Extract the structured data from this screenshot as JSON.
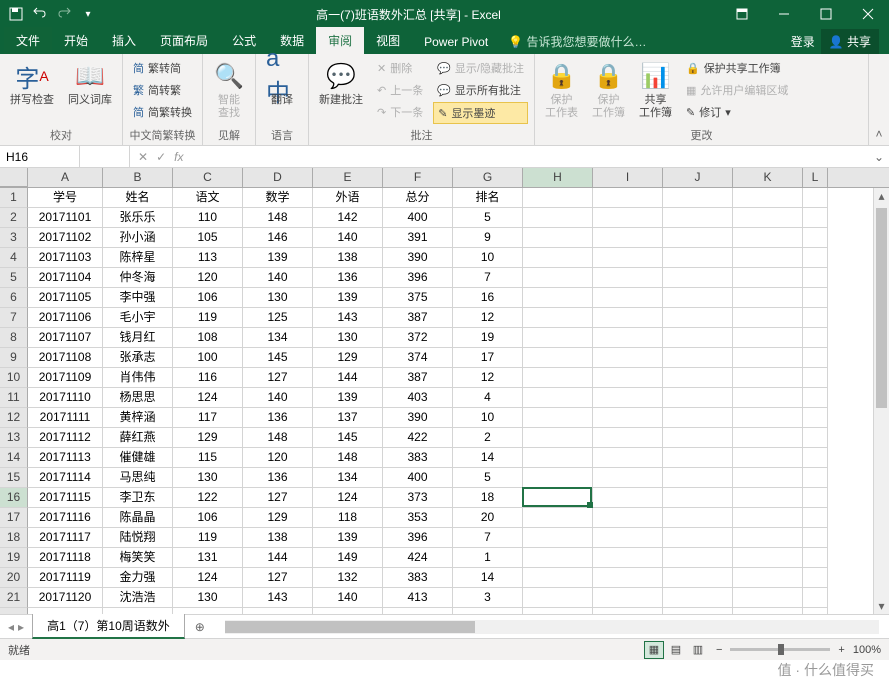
{
  "title": "高一(7)班语数外汇总 [共享] - Excel",
  "tabs": {
    "file": "文件",
    "home": "开始",
    "insert": "插入",
    "layout": "页面布局",
    "formulas": "公式",
    "data": "数据",
    "review": "审阅",
    "view": "视图",
    "powerpivot": "Power Pivot",
    "tellme": "告诉我您想要做什么…",
    "login": "登录",
    "share": "共享"
  },
  "ribbon": {
    "proofing": {
      "label": "校对",
      "spellcheck": "拼写检查",
      "thesaurus": "同义词库"
    },
    "chinese": {
      "label": "中文简繁转换",
      "s2t": "繁转简",
      "t2s": "简转繁",
      "conv": "简繁转换"
    },
    "insights": {
      "label": "见解",
      "smart": "智能\n查找"
    },
    "language": {
      "label": "语言",
      "translate": "翻译"
    },
    "comments": {
      "label": "批注",
      "new": "新建批注",
      "delete": "删除",
      "prev": "上一条",
      "next": "下一条",
      "showhide": "显示/隐藏批注",
      "showall": "显示所有批注",
      "ink": "显示墨迹"
    },
    "changes": {
      "label": "更改",
      "protect_sheet": "保护\n工作表",
      "protect_wb": "保护\n工作簿",
      "share_wb": "共享\n工作簿",
      "protect_share": "保护共享工作簿",
      "allow_edit": "允许用户编辑区域",
      "track": "修订"
    }
  },
  "namebox": "H16",
  "formula": "",
  "columns": [
    "A",
    "B",
    "C",
    "D",
    "E",
    "F",
    "G",
    "H",
    "I",
    "J",
    "K",
    "L"
  ],
  "headers": [
    "学号",
    "姓名",
    "语文",
    "数学",
    "外语",
    "总分",
    "排名"
  ],
  "data_rows": [
    [
      "20171101",
      "张乐乐",
      "110",
      "148",
      "142",
      "400",
      "5"
    ],
    [
      "20171102",
      "孙小涵",
      "105",
      "146",
      "140",
      "391",
      "9"
    ],
    [
      "20171103",
      "陈梓星",
      "113",
      "139",
      "138",
      "390",
      "10"
    ],
    [
      "20171104",
      "仲冬海",
      "120",
      "140",
      "136",
      "396",
      "7"
    ],
    [
      "20171105",
      "李中强",
      "106",
      "130",
      "139",
      "375",
      "16"
    ],
    [
      "20171106",
      "毛小宇",
      "119",
      "125",
      "143",
      "387",
      "12"
    ],
    [
      "20171107",
      "钱月红",
      "108",
      "134",
      "130",
      "372",
      "19"
    ],
    [
      "20171108",
      "张承志",
      "100",
      "145",
      "129",
      "374",
      "17"
    ],
    [
      "20171109",
      "肖伟伟",
      "116",
      "127",
      "144",
      "387",
      "12"
    ],
    [
      "20171110",
      "杨思思",
      "124",
      "140",
      "139",
      "403",
      "4"
    ],
    [
      "20171111",
      "黄梓涵",
      "117",
      "136",
      "137",
      "390",
      "10"
    ],
    [
      "20171112",
      "薛红燕",
      "129",
      "148",
      "145",
      "422",
      "2"
    ],
    [
      "20171113",
      "催健雄",
      "115",
      "120",
      "148",
      "383",
      "14"
    ],
    [
      "20171114",
      "马思纯",
      "130",
      "136",
      "134",
      "400",
      "5"
    ],
    [
      "20171115",
      "李卫东",
      "122",
      "127",
      "124",
      "373",
      "18"
    ],
    [
      "20171116",
      "陈晶晶",
      "106",
      "129",
      "118",
      "353",
      "20"
    ],
    [
      "20171117",
      "陆悦翔",
      "119",
      "138",
      "139",
      "396",
      "7"
    ],
    [
      "20171118",
      "梅笑笑",
      "131",
      "144",
      "149",
      "424",
      "1"
    ],
    [
      "20171119",
      "金力强",
      "124",
      "127",
      "132",
      "383",
      "14"
    ],
    [
      "20171120",
      "沈浩浩",
      "130",
      "143",
      "140",
      "413",
      "3"
    ]
  ],
  "sheet_tab": "高1（7）第10周语数外",
  "status": "就绪",
  "zoom": "100%",
  "watermark": "值 · 什么值得买",
  "active": {
    "row": 16,
    "col": "H"
  }
}
